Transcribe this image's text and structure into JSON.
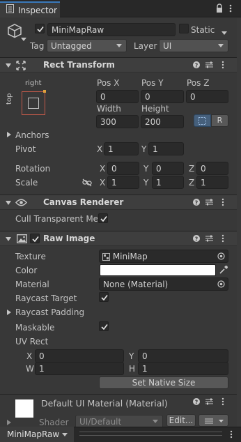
{
  "tab": {
    "title": "Inspector"
  },
  "object": {
    "name": "MiniMapRaw",
    "static_label": "Static",
    "tag_label": "Tag",
    "tag_value": "Untagged",
    "layer_label": "Layer",
    "layer_value": "UI"
  },
  "rect_transform": {
    "title": "Rect Transform",
    "anchor_h": "right",
    "anchor_v": "top",
    "pos_x_label": "Pos X",
    "pos_y_label": "Pos Y",
    "pos_z_label": "Pos Z",
    "pos_x": "0",
    "pos_y": "0",
    "pos_z": "0",
    "width_label": "Width",
    "height_label": "Height",
    "width": "300",
    "height": "200",
    "raw_edit": "R",
    "anchors_label": "Anchors",
    "pivot_label": "Pivot",
    "pivot_x": "1",
    "pivot_y": "1",
    "rotation_label": "Rotation",
    "rot_x": "0",
    "rot_y": "0",
    "rot_z": "0",
    "scale_label": "Scale",
    "scale_x": "1",
    "scale_y": "1",
    "scale_z": "1",
    "x": "X",
    "y": "Y",
    "z": "Z"
  },
  "canvas_renderer": {
    "title": "Canvas Renderer",
    "cull_label": "Cull Transparent Mes",
    "cull_checked": true
  },
  "raw_image": {
    "title": "Raw Image",
    "texture_label": "Texture",
    "texture_value": "MiniMap",
    "color_label": "Color",
    "color_value": "#ffffff",
    "material_label": "Material",
    "material_value": "None (Material)",
    "raycast_target_label": "Raycast Target",
    "raycast_padding_label": "Raycast Padding",
    "maskable_label": "Maskable",
    "uv_rect_label": "UV Rect",
    "uv_x": "0",
    "uv_y": "0",
    "uv_w": "1",
    "uv_h": "1",
    "x": "X",
    "y": "Y",
    "w": "W",
    "h": "H",
    "native_size_button": "Set Native Size"
  },
  "material_preview": {
    "title": "Default UI Material (Material)",
    "shader_label": "Shader",
    "shader_value": "UI/Default",
    "edit_button": "Edit..."
  },
  "footer": {
    "object_label": "MiniMapRaw"
  }
}
